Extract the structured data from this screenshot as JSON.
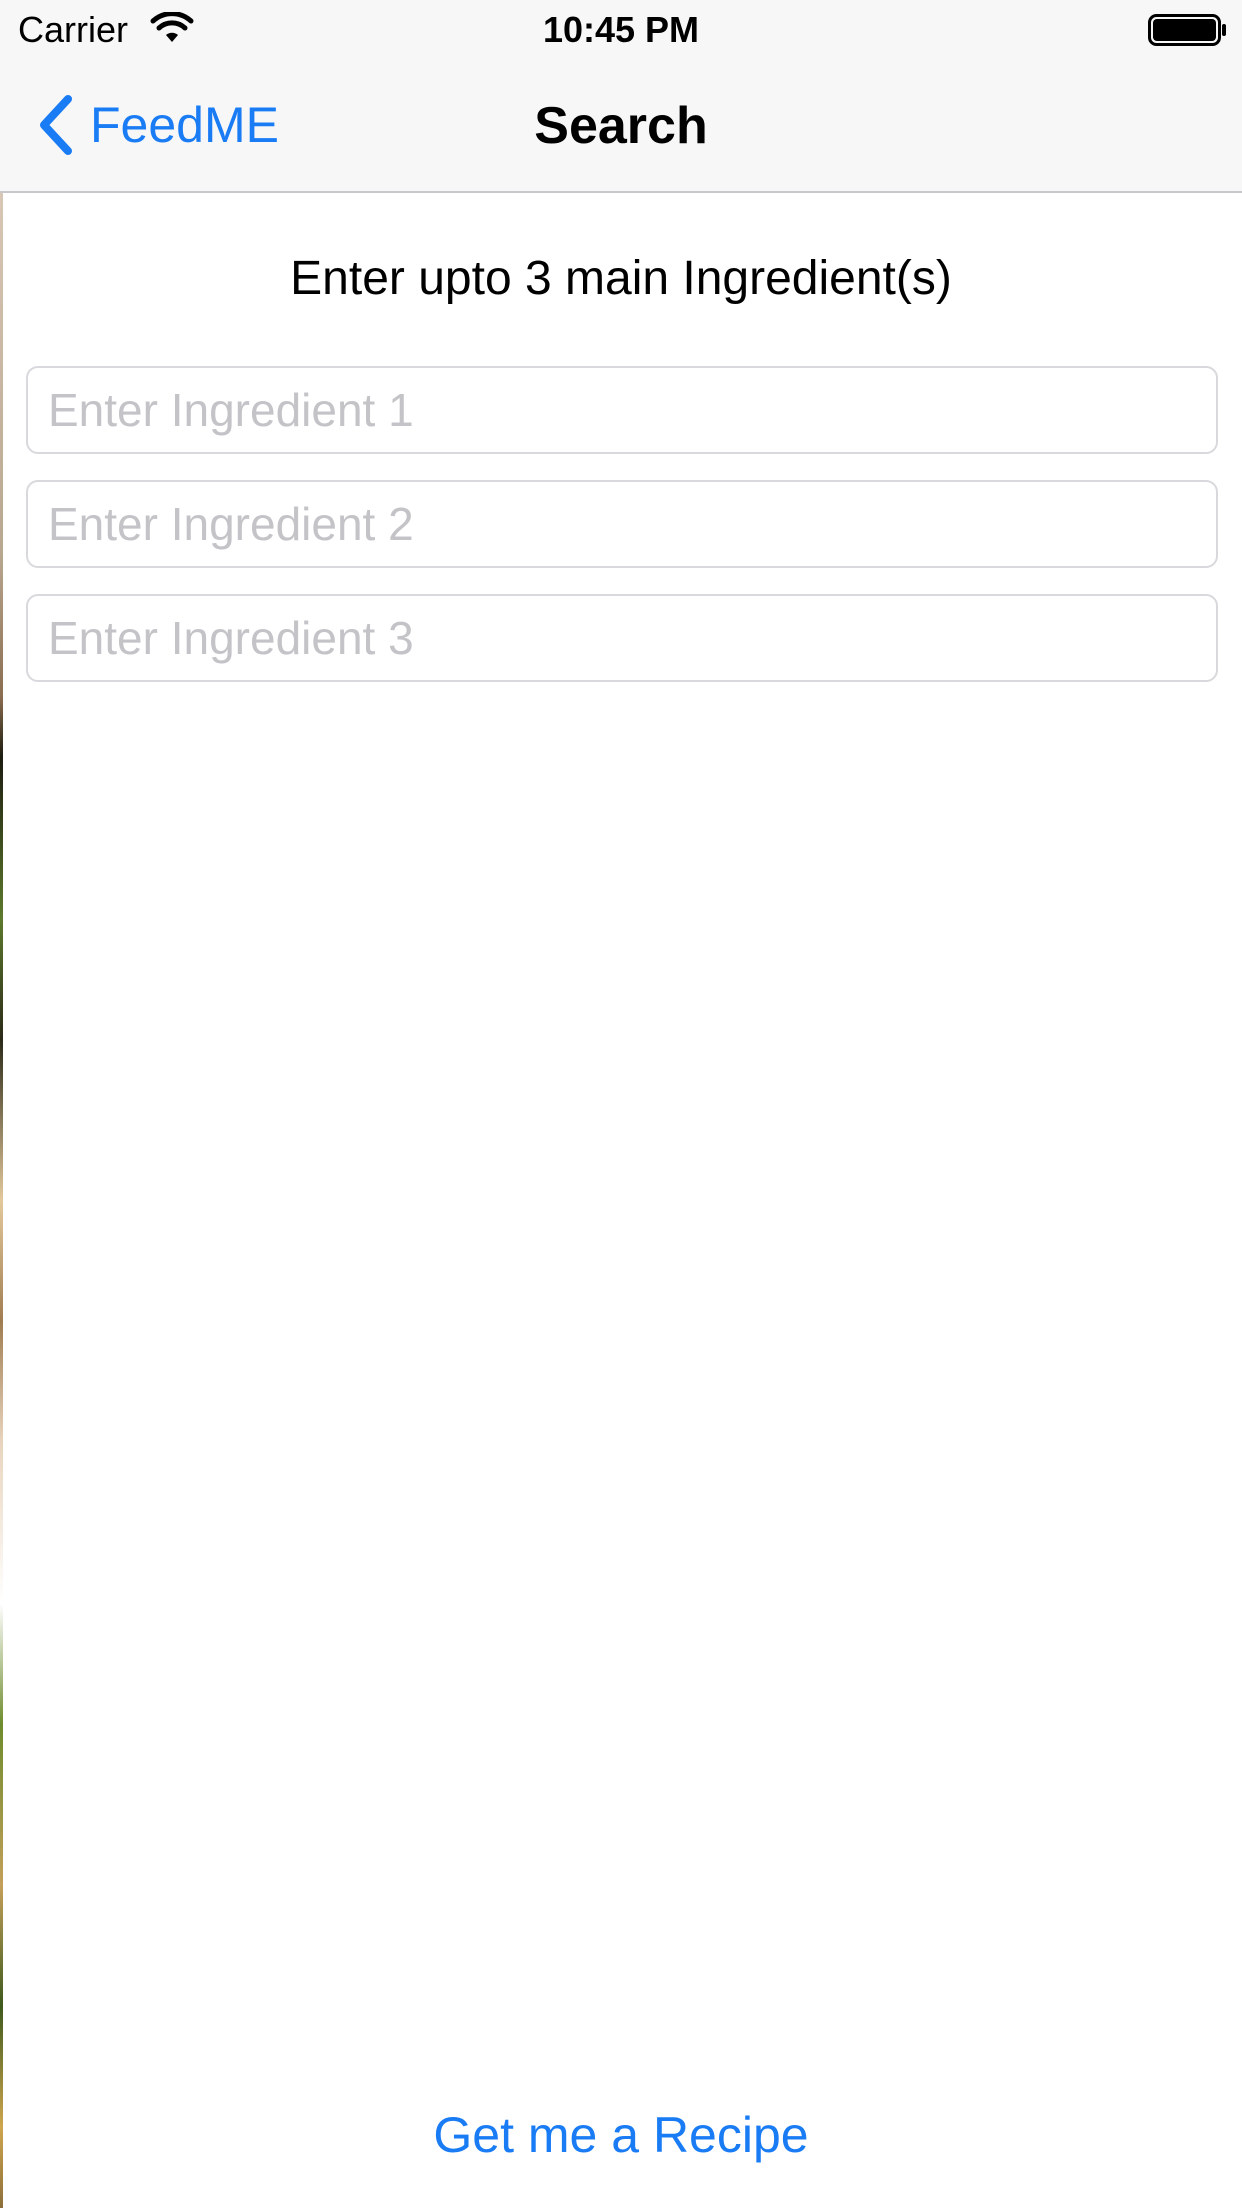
{
  "status_bar": {
    "carrier": "Carrier",
    "time": "10:45 PM",
    "wifi_icon": "wifi-icon",
    "battery_icon": "battery-full-icon"
  },
  "nav": {
    "back_label": "FeedME",
    "back_icon": "chevron-left-icon",
    "title": "Search"
  },
  "main": {
    "instruction": "Enter upto 3 main Ingredient(s)",
    "inputs": [
      {
        "value": "",
        "placeholder": "Enter Ingredient 1"
      },
      {
        "value": "",
        "placeholder": "Enter Ingredient 2"
      },
      {
        "value": "",
        "placeholder": "Enter Ingredient 3"
      }
    ],
    "submit_label": "Get me a Recipe"
  },
  "colors": {
    "accent": "#1a7cf5",
    "bar_background": "#f7f7f7",
    "placeholder": "#c4c4c8",
    "input_border": "#d9d9dd"
  }
}
